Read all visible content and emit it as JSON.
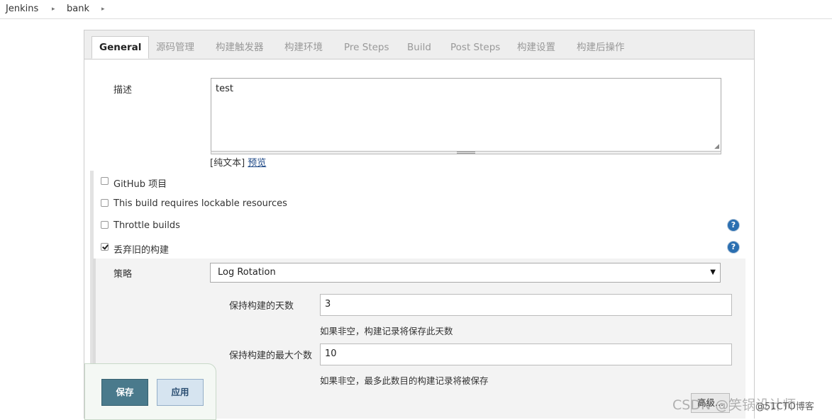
{
  "breadcrumb": {
    "items": [
      "Jenkins",
      "bank"
    ],
    "separator": "▸"
  },
  "tabs": {
    "items": [
      "General",
      "源码管理",
      "构建触发器",
      "构建环境",
      "Pre Steps",
      "Build",
      "Post Steps",
      "构建设置",
      "构建后操作"
    ],
    "active": "General"
  },
  "description": {
    "label": "描述",
    "value": "test",
    "plain_text": "[纯文本]",
    "preview_link": "预览"
  },
  "options": {
    "github_project": {
      "label": "GitHub 项目",
      "checked": false
    },
    "lockable_resources": {
      "label": "This build requires lockable resources",
      "checked": false
    },
    "throttle_builds": {
      "label": "Throttle builds",
      "checked": false
    },
    "discard_old_builds": {
      "label": "丢弃旧的构建",
      "checked": true
    }
  },
  "strategy": {
    "label": "策略",
    "selected": "Log Rotation",
    "days_to_keep": {
      "label": "保持构建的天数",
      "value": "3",
      "hint": "如果非空，构建记录将保存此天数"
    },
    "max_builds": {
      "label": "保持构建的最大个数",
      "value": "10",
      "hint": "如果非空，最多此数目的构建记录将被保存"
    },
    "advanced_button": "高级..."
  },
  "actions": {
    "save": "保存",
    "apply": "应用"
  },
  "help_icon_glyph": "?",
  "watermark": "CSDN @笑锅设计师",
  "watermark_mark": "@51CTO博客",
  "colors": {
    "save_bg": "#4a7a8c",
    "apply_bg": "#d6e4f0",
    "help": "#2b6fb1"
  }
}
